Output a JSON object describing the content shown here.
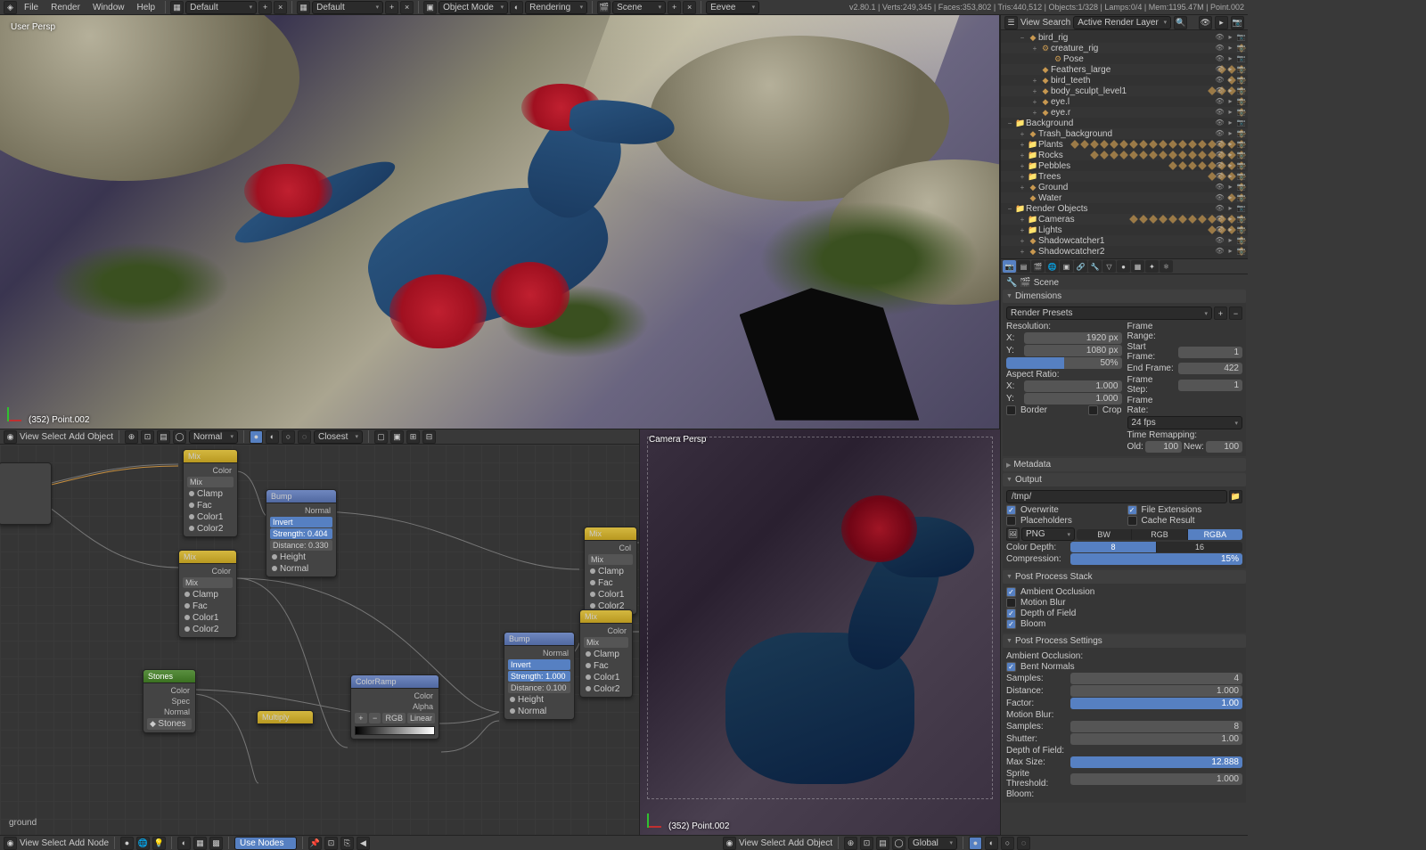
{
  "topmenu": {
    "file": "File",
    "render": "Render",
    "window": "Window",
    "help": "Help"
  },
  "toplayout1": "Default",
  "toplayout2": "Default",
  "mode": "Object Mode",
  "shading": "Rendering",
  "scene": "Scene",
  "engine": "Eevee",
  "stats": "v2.80.1 | Verts:249,345 | Faces:353,802 | Tris:440,512 | Objects:1/328 | Lamps:0/4 | Mem:1195.47M | Point.002",
  "vp": {
    "persp": "User Persp",
    "sel": "(352) Point.002"
  },
  "cam": {
    "label": "Camera Persp",
    "sel": "(352) Point.002"
  },
  "hdr": {
    "view": "View",
    "select": "Select",
    "add": "Add",
    "object": "Object",
    "node": "Node",
    "normal": "Normal",
    "closest": "Closest",
    "global": "Global",
    "usenodes": "Use Nodes"
  },
  "outliner": {
    "view": "View",
    "search": "Search",
    "layer": "Active Render Layer",
    "items": [
      {
        "ind": 1,
        "exp": "−",
        "icon": "◆",
        "name": "bird_rig",
        "ci": 0
      },
      {
        "ind": 2,
        "exp": "+",
        "icon": "⚙",
        "name": "creature_rig",
        "ci": 1
      },
      {
        "ind": 3,
        "exp": "",
        "icon": "⚙",
        "name": "Pose",
        "ci": 0
      },
      {
        "ind": 2,
        "exp": "",
        "icon": "◆",
        "name": "Feathers_large",
        "ci": 3
      },
      {
        "ind": 2,
        "exp": "+",
        "icon": "◆",
        "name": "bird_teeth",
        "ci": 2
      },
      {
        "ind": 2,
        "exp": "+",
        "icon": "◆",
        "name": "body_sculpt_level1",
        "ci": 4
      },
      {
        "ind": 2,
        "exp": "+",
        "icon": "◆",
        "name": "eye.l",
        "ci": 1
      },
      {
        "ind": 2,
        "exp": "+",
        "icon": "◆",
        "name": "eye.r",
        "ci": 1
      },
      {
        "ind": 0,
        "exp": "−",
        "icon": "📁",
        "name": "Background",
        "ci": 0
      },
      {
        "ind": 1,
        "exp": "+",
        "icon": "◆",
        "name": "Trash_background",
        "ci": 1
      },
      {
        "ind": 1,
        "exp": "+",
        "icon": "📁",
        "name": "Plants",
        "ci": 18
      },
      {
        "ind": 1,
        "exp": "+",
        "icon": "📁",
        "name": "Rocks",
        "ci": 16
      },
      {
        "ind": 1,
        "exp": "+",
        "icon": "📁",
        "name": "Pebbles",
        "ci": 8
      },
      {
        "ind": 1,
        "exp": "+",
        "icon": "📁",
        "name": "Trees",
        "ci": 4
      },
      {
        "ind": 1,
        "exp": "+",
        "icon": "◆",
        "name": "Ground",
        "ci": 1
      },
      {
        "ind": 1,
        "exp": "",
        "icon": "◆",
        "name": "Water",
        "ci": 2
      },
      {
        "ind": 0,
        "exp": "−",
        "icon": "📁",
        "name": "Render Objects",
        "ci": 0
      },
      {
        "ind": 1,
        "exp": "+",
        "icon": "📁",
        "name": "Cameras",
        "ci": 12
      },
      {
        "ind": 1,
        "exp": "+",
        "icon": "📁",
        "name": "Lights",
        "ci": 4
      },
      {
        "ind": 1,
        "exp": "+",
        "icon": "◆",
        "name": "Shadowcatcher1",
        "ci": 1
      },
      {
        "ind": 1,
        "exp": "+",
        "icon": "◆",
        "name": "Shadowcatcher2",
        "ci": 1
      }
    ]
  },
  "nodes": {
    "mix1": {
      "title": "Mix",
      "out": "Color",
      "type": "Mix",
      "rows": [
        "Clamp",
        "Fac",
        "Color1",
        "Color2"
      ]
    },
    "mix2": {
      "title": "Mix",
      "out": "Color",
      "type": "Mix",
      "rows": [
        "Clamp",
        "Fac",
        "Color1",
        "Color2"
      ]
    },
    "mix3": {
      "title": "Mix",
      "out": "Col",
      "type": "Mix",
      "rows": [
        "Clamp",
        "Fac",
        "Color1",
        "Color2"
      ]
    },
    "mix4": {
      "title": "Mix",
      "out": "Color",
      "type": "Mix",
      "rows": [
        "Clamp",
        "Fac",
        "Color1",
        "Color2"
      ]
    },
    "bump1": {
      "title": "Bump",
      "out": "Normal",
      "inv": "Invert",
      "str": "Strength: 0.404",
      "dist": "Distance: 0.330",
      "rows": [
        "Height",
        "Normal"
      ]
    },
    "bump2": {
      "title": "Bump",
      "out": "Normal",
      "inv": "Invert",
      "str": "Strength: 1.000",
      "dist": "Distance: 0.100",
      "rows": [
        "Height",
        "Normal"
      ]
    },
    "stones": {
      "title": "Stones",
      "rows": [
        "Color",
        "Spec",
        "Normal"
      ],
      "btn": "Stones"
    },
    "mult": {
      "title": "Multiply"
    },
    "ramp": {
      "title": "ColorRamp",
      "rows": [
        "Color",
        "Alpha"
      ],
      "mode": "RGB",
      "interp": "Linear"
    },
    "matname": "ground"
  },
  "props": {
    "scene": "Scene",
    "dimensions": "Dimensions",
    "presets": "Render Presets",
    "res": "Resolution:",
    "x": "X:",
    "y": "Y:",
    "xval": "1920 px",
    "yval": "1080 px",
    "pct": "50%",
    "aspect": "Aspect Ratio:",
    "ax": "1.000",
    "ay": "1.000",
    "border": "Border",
    "crop": "Crop",
    "frange": "Frame Range:",
    "sf": "Start Frame:",
    "ef": "End Frame:",
    "fs": "Frame Step:",
    "sfv": "1",
    "efv": "422",
    "fsv": "1",
    "frate": "Frame Rate:",
    "fps": "24 fps",
    "tremap": "Time Remapping:",
    "old": "Old:",
    "new": "New:",
    "oldv": "100",
    "newv": "100",
    "metadata": "Metadata",
    "output": "Output",
    "path": "/tmp/",
    "overwrite": "Overwrite",
    "fext": "File Extensions",
    "placeholders": "Placeholders",
    "cache": "Cache Result",
    "fmt": "PNG",
    "bw": "BW",
    "rgb": "RGB",
    "rgba": "RGBA",
    "cdepth": "Color Depth:",
    "cd8": "8",
    "cd16": "16",
    "compression": "Compression:",
    "compv": "15%",
    "pps": "Post Process Stack",
    "ao": "Ambient Occlusion",
    "mb": "Motion Blur",
    "dof": "Depth of Field",
    "bloom": "Bloom",
    "ppset": "Post Process Settings",
    "aohdr": "Ambient Occlusion:",
    "bn": "Bent Normals",
    "samples": "Samples:",
    "sampv": "4",
    "dist": "Distance:",
    "distv": "1.000",
    "factor": "Factor:",
    "factorv": "1.00",
    "mbhdr": "Motion Blur:",
    "mbsamp": "8",
    "shutter": "Shutter:",
    "shutv": "1.00",
    "dofhdr": "Depth of Field:",
    "maxsize": "Max Size:",
    "maxsv": "12.888",
    "sprite": "Sprite Threshold:",
    "spritev": "1.000",
    "bloomhdr": "Bloom:"
  }
}
